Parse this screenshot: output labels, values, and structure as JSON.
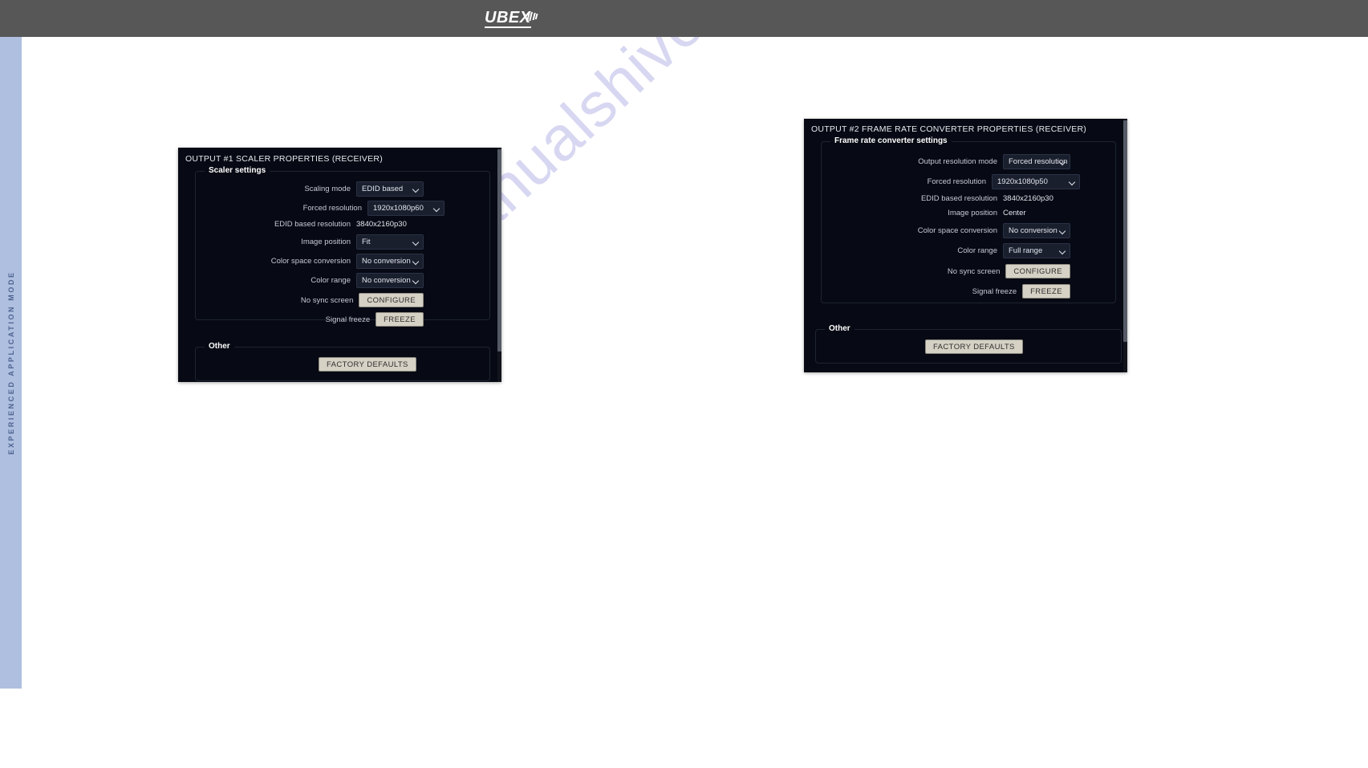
{
  "header": {
    "logo_text": "UBEX",
    "logo_icon": "ubex-stripes-icon",
    "background": "#575757"
  },
  "sidebar": {
    "label": "EXPERIENCED APPLICATION MODE",
    "background": "#aebfe0"
  },
  "watermark": {
    "text": "manualshive.com"
  },
  "panels": [
    {
      "id": "output1",
      "title": "OUTPUT #1 SCALER PROPERTIES (RECEIVER)",
      "settings_legend": "Scaler settings",
      "other_legend": "Other",
      "factory_defaults_label": "FACTORY DEFAULTS",
      "rows": [
        {
          "label": "Scaling mode",
          "kind": "select",
          "value": "EDID based"
        },
        {
          "label": "Forced resolution",
          "kind": "select",
          "value": "1920x1080p60"
        },
        {
          "label": "EDID based resolution",
          "kind": "static",
          "value": "3840x2160p30"
        },
        {
          "label": "Image position",
          "kind": "select",
          "value": "Fit"
        },
        {
          "label": "Color space conversion",
          "kind": "select",
          "value": "No conversion"
        },
        {
          "label": "Color range",
          "kind": "select",
          "value": "No conversion"
        },
        {
          "label": "No sync screen",
          "kind": "button",
          "value": "CONFIGURE"
        },
        {
          "label": "Signal freeze",
          "kind": "button",
          "value": "FREEZE"
        }
      ]
    },
    {
      "id": "output2",
      "title": "OUTPUT #2 FRAME RATE CONVERTER PROPERTIES (RECEIVER)",
      "settings_legend": "Frame rate converter settings",
      "other_legend": "Other",
      "factory_defaults_label": "FACTORY DEFAULTS",
      "rows": [
        {
          "label": "Output resolution mode",
          "kind": "select",
          "value": "Forced resolution"
        },
        {
          "label": "Forced resolution",
          "kind": "select",
          "value": "1920x1080p50"
        },
        {
          "label": "EDID based resolution",
          "kind": "static",
          "value": "3840x2160p30"
        },
        {
          "label": "Image position",
          "kind": "static",
          "value": "Center"
        },
        {
          "label": "Color space conversion",
          "kind": "select",
          "value": "No conversion"
        },
        {
          "label": "Color range",
          "kind": "select",
          "value": "Full range"
        },
        {
          "label": "No sync screen",
          "kind": "button",
          "value": "CONFIGURE"
        },
        {
          "label": "Signal freeze",
          "kind": "button",
          "value": "FREEZE"
        }
      ]
    }
  ],
  "colors": {
    "panel_bg": "#070a14",
    "field_bg": "#1a1f2e",
    "button_bg": "#d5d1c4",
    "accent_text": "#ffffff"
  }
}
